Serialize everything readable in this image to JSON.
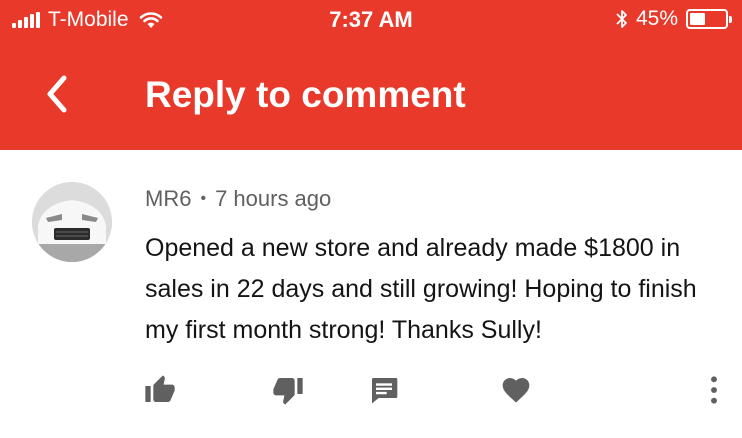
{
  "status_bar": {
    "carrier": "T-Mobile",
    "time": "7:37 AM",
    "battery": "45%",
    "battery_level": 0.45
  },
  "nav": {
    "title": "Reply to comment"
  },
  "comment": {
    "author": "MR6",
    "separator": "•",
    "timestamp": "7 hours ago",
    "text": "Opened a new store and already made $1800 in sales in 22 days and still growing! Hoping to finish my first month strong! Thanks Sully!"
  },
  "colors": {
    "accent": "#e8392b",
    "icon": "#606060",
    "text": "#141414"
  },
  "icons": {
    "back": "chevron-left-icon",
    "like": "thumbs-up-icon",
    "dislike": "thumbs-down-icon",
    "reply": "comment-icon",
    "heart": "heart-icon",
    "more": "more-vertical-icon"
  }
}
